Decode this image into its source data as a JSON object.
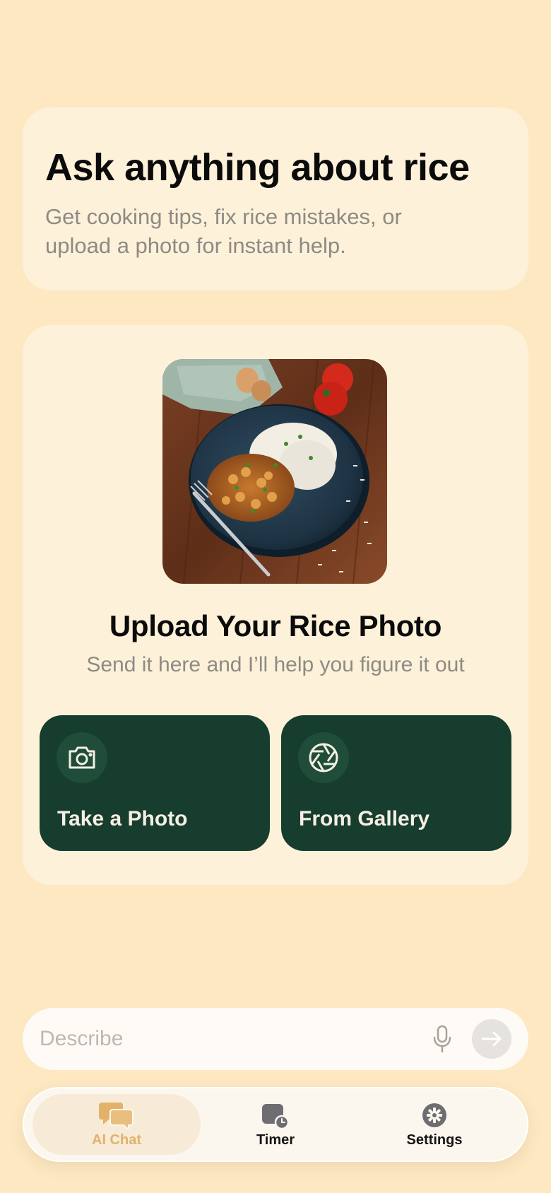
{
  "hero": {
    "title": "Ask anything about rice",
    "subtitle": "Get cooking tips, fix rice mistakes, or upload a photo for instant help."
  },
  "upload": {
    "image_icon": "rice-dish-photo",
    "title": "Upload Your Rice Photo",
    "subtitle": "Send it here and I’ll help you figure it out",
    "actions": [
      {
        "label": "Take a Photo",
        "icon": "camera-icon"
      },
      {
        "label": "From Gallery",
        "icon": "aperture-icon"
      }
    ]
  },
  "composer": {
    "placeholder": "Describe",
    "mic_icon": "microphone-icon",
    "send_icon": "arrow-right-icon"
  },
  "tabs": [
    {
      "label": "AI Chat",
      "icon": "chat-bubbles-icon",
      "active": true
    },
    {
      "label": "Timer",
      "icon": "timer-icon",
      "active": false
    },
    {
      "label": "Settings",
      "icon": "gear-icon",
      "active": false
    }
  ],
  "colors": {
    "background": "#FDE8C2",
    "card": "#FEF1DA",
    "action_button": "#163D2D",
    "active_tab": "#E2B26A"
  }
}
